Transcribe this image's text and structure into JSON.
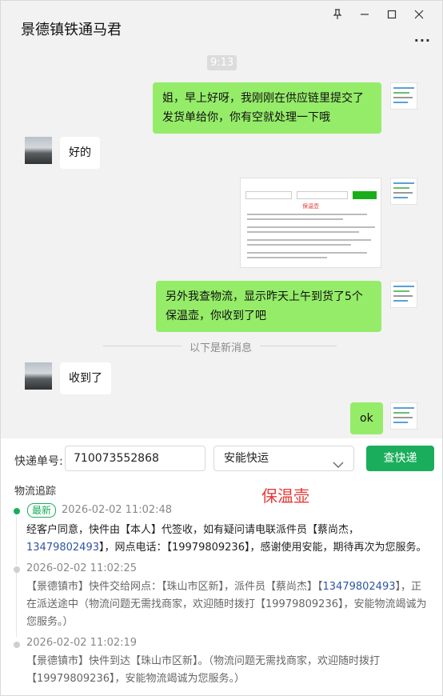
{
  "window": {
    "title": "景德镇铁通马君",
    "more": "..."
  },
  "chat": {
    "time": "9:13",
    "messages": [
      {
        "side": "right",
        "text": "姐，早上好呀，我刚刚在供应链里提交了发货单给你，你有空就处理一下哦"
      },
      {
        "side": "left",
        "text": "好的"
      },
      {
        "side": "right",
        "type": "image",
        "caption": "保温壶"
      },
      {
        "side": "right",
        "text": "另外我查物流，显示昨天上午到货了5个保温壶，你收到了吧"
      },
      {
        "side": "left",
        "text": "收到了"
      },
      {
        "side": "right",
        "text": "ok"
      }
    ],
    "new_messages_divider": "以下是新消息"
  },
  "tracking": {
    "number_label": "快递单号:",
    "number_value": "710073552868",
    "courier_selected": "安能快运",
    "query_button": "查快递",
    "section_title": "物流追踪",
    "annotation": "保温壶",
    "latest_badge": "最新",
    "events": [
      {
        "time": "2026-02-02 11:02:48",
        "p1": "经客户同意，快件由【本人】代签收，如有疑问请电联派件员【蔡尚杰，",
        "phone": "13479802493",
        "p2": "】，网点电话：【19979809236】，感谢使用安能，期待再次为您服务。"
      },
      {
        "time": "2026-02-02 11:02:25",
        "p1": "【景德镇市】快件交给网点：【珠山市区新】，派件员【蔡尚杰】【",
        "phone": "13479802493",
        "p2": "】，正在派送途中（物流问题无需找商家，欢迎随时拨打【19979809236】，安能物流竭诚为您服务。）"
      },
      {
        "time": "2026-02-02 11:02:19",
        "p1": "【景德镇市】快件到达【珠山市区新】。（物流问题无需找商家，欢迎随时拨打【19979809236】，安能物流竭诚为您服务。）"
      }
    ]
  },
  "colors": {
    "bubble_green": "#95ec69",
    "accent_green": "#1aad5b",
    "annotation_red": "#e53935",
    "phone_blue": "#2f55a4"
  }
}
